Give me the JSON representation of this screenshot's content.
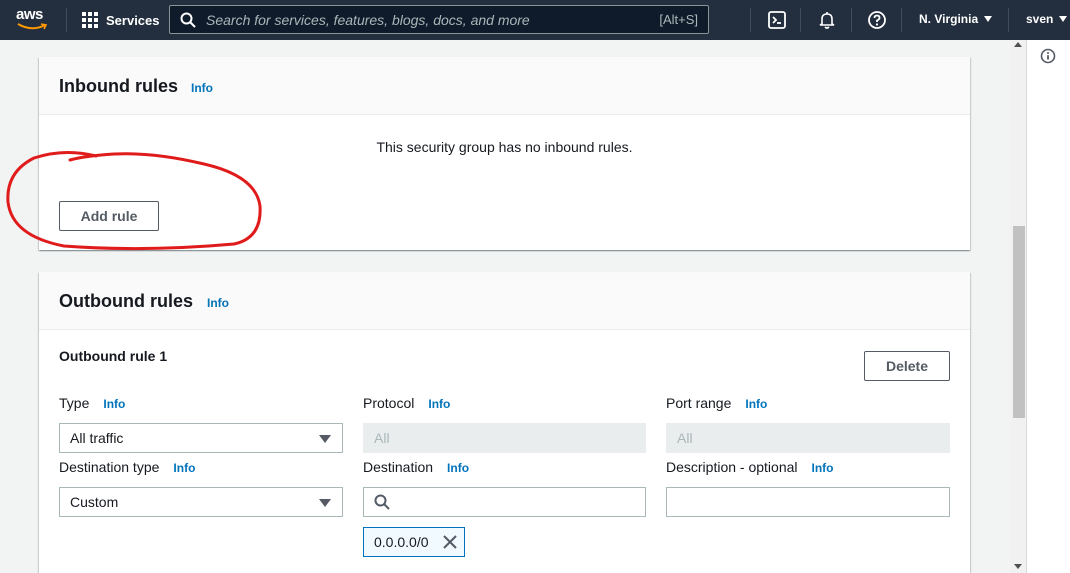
{
  "nav": {
    "logo": "aws",
    "services_label": "Services",
    "search_placeholder": "Search for services, features, blogs, docs, and more",
    "search_shortcut": "[Alt+S]",
    "region": "N. Virginia",
    "user": "sven",
    "icons": [
      "cloudshell-icon",
      "bell-icon",
      "help-icon"
    ]
  },
  "inbound": {
    "title": "Inbound rules",
    "info": "Info",
    "empty_text": "This security group has no inbound rules.",
    "add_rule_label": "Add rule"
  },
  "outbound": {
    "title": "Outbound rules",
    "info": "Info",
    "rule_title": "Outbound rule 1",
    "delete_label": "Delete",
    "type": {
      "label": "Type",
      "info": "Info",
      "value": "All traffic"
    },
    "protocol": {
      "label": "Protocol",
      "info": "Info",
      "value": "All"
    },
    "port_range": {
      "label": "Port range",
      "info": "Info",
      "value": "All"
    },
    "destination_type": {
      "label": "Destination type",
      "info": "Info",
      "value": "Custom"
    },
    "destination": {
      "label": "Destination",
      "info": "Info",
      "value": "",
      "token": "0.0.0.0/0"
    },
    "description": {
      "label": "Description - optional",
      "info": "Info",
      "value": ""
    }
  },
  "colors": {
    "nav_bg": "#232f3e",
    "link": "#0073bb",
    "annotation": "#e01b1b"
  }
}
